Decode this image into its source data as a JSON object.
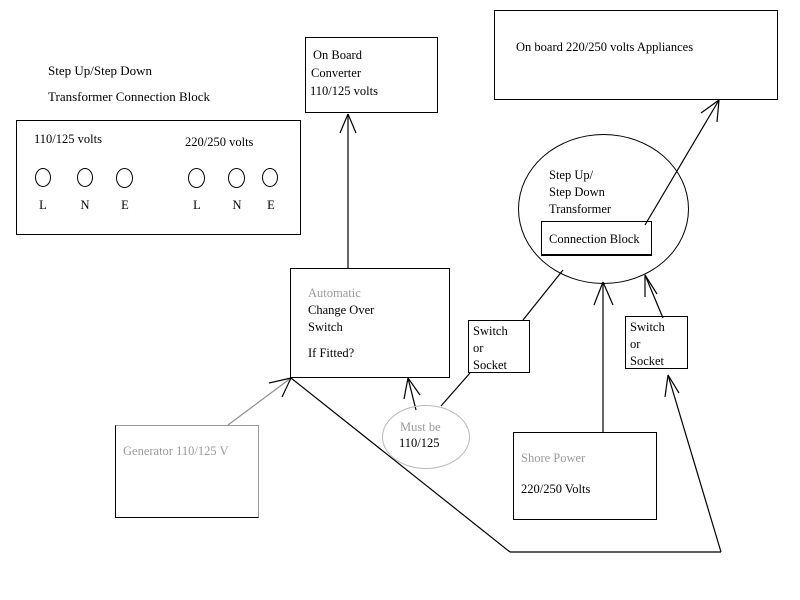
{
  "diagram": {
    "title_lines": [
      "Step Up/Step Down",
      "Transformer Connection Block"
    ],
    "background_color": "#ffffff",
    "line_color": "#000000",
    "dim_color": "#9a9a9a"
  },
  "connection_block_panel": {
    "left_group_label": "110/125 volts",
    "right_group_label": "220/250 volts",
    "terminals": [
      {
        "label": "L",
        "group": "110/125"
      },
      {
        "label": "N",
        "group": "110/125"
      },
      {
        "label": "E",
        "group": "110/125"
      },
      {
        "label": "L",
        "group": "220/250"
      },
      {
        "label": "N",
        "group": "220/250"
      },
      {
        "label": "E",
        "group": "220/250"
      }
    ]
  },
  "converter_box": {
    "line1": "On Board",
    "line2": "Converter",
    "line3": "110/125 volts"
  },
  "appliances_box": {
    "label": "On board 220/250 volts Appliances"
  },
  "transformer_circle": {
    "line1": "Step Up/",
    "line2": "Step Down",
    "line3": "Transformer",
    "inner_block_label": "Connection Block"
  },
  "changeover_box": {
    "line1": "Automatic",
    "line2": "Change Over",
    "line3": "Switch",
    "line4": "If Fitted?"
  },
  "switch_socket_left": {
    "line1": "Switch",
    "line2": "or",
    "line3": "Socket"
  },
  "switch_socket_right": {
    "line1": "Switch",
    "line2": "or",
    "line3": "Socket"
  },
  "must_be_note": {
    "line1": "Must be",
    "line2": "110/125"
  },
  "generator_box": {
    "label": "Generator 110/125 V"
  },
  "shore_power_box": {
    "line1": "Shore Power",
    "line2": "220/250 Volts"
  }
}
